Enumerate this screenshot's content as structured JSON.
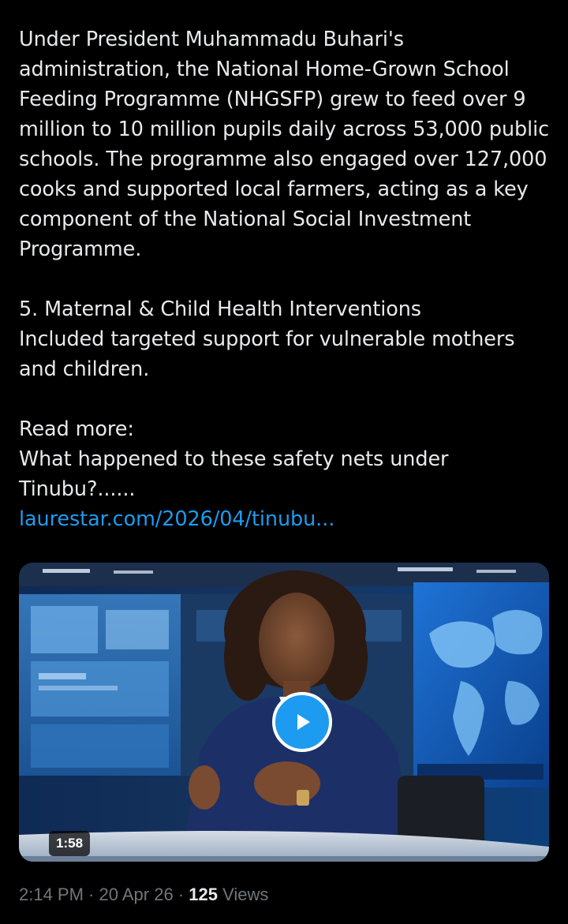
{
  "tweet": {
    "paragraph_1": "Under President Muhammadu Buhari's administration, the National Home-Grown School Feeding Programme (NHGSFP) grew to feed over 9 million to 10 million pupils daily across 53,000 public schools. The programme also engaged over 127,000 cooks and supported local farmers, acting as a key component of the National Social Investment Programme.",
    "section_heading": "5. Maternal & Child Health Interventions",
    "section_text": "Included targeted support for vulnerable mothers and children.",
    "read_more": "Read more:",
    "question": "What happened to these safety nets under Tinubu?......",
    "link_text": "laurestar.com/2026/04/tinubu..."
  },
  "video": {
    "duration": "1:58",
    "play_icon": "play-icon",
    "accent_color": "#1d9bf0"
  },
  "meta": {
    "time": "2:14 PM",
    "separator_1": " · ",
    "date": "20 Apr 26",
    "separator_2": " · ",
    "views_count": "125",
    "views_label": " Views"
  },
  "colors": {
    "background": "#000000",
    "text": "#e7e9ea",
    "muted": "#71767b",
    "link": "#1d9bf0"
  }
}
